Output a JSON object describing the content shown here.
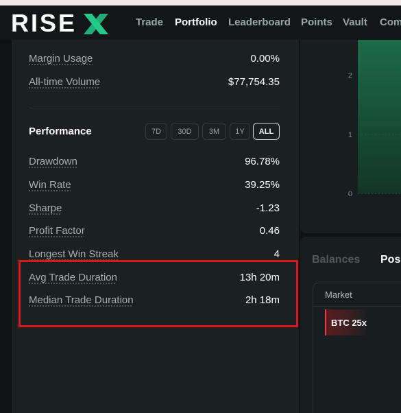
{
  "brand": {
    "logo_text": "RISE",
    "logo_mark": "X",
    "accent": "#22c98a"
  },
  "nav": {
    "items": [
      {
        "label": "Trade",
        "active": false
      },
      {
        "label": "Portfolio",
        "active": true
      },
      {
        "label": "Leaderboard",
        "active": false
      },
      {
        "label": "Points",
        "active": false
      },
      {
        "label": "Vault",
        "active": false
      },
      {
        "label": "Com",
        "active": false
      }
    ]
  },
  "summary": {
    "margin_usage": {
      "label": "Margin Usage",
      "value": "0.00%"
    },
    "alltime_volume": {
      "label": "All-time Volume",
      "value": "$77,754.35"
    }
  },
  "performance": {
    "title": "Performance",
    "timeframes": [
      "7D",
      "30D",
      "3M",
      "1Y",
      "ALL"
    ],
    "selected_timeframe": "ALL",
    "metrics": [
      {
        "label": "Drawdown",
        "value": "96.78%"
      },
      {
        "label": "Win Rate",
        "value": "39.25%"
      },
      {
        "label": "Sharpe",
        "value": "-1.23"
      },
      {
        "label": "Profit Factor",
        "value": "0.46"
      },
      {
        "label": "Longest Win Streak",
        "value": "4"
      },
      {
        "label": "Avg Trade Duration",
        "value": "13h 20m"
      },
      {
        "label": "Median Trade Duration",
        "value": "2h 18m"
      }
    ]
  },
  "chart_data": {
    "type": "area",
    "y_ticks": [
      "2",
      "1",
      "0"
    ],
    "ylim": [
      0,
      2.6
    ],
    "grid": true,
    "fill_color": "#1d6b47"
  },
  "positions": {
    "tabs": [
      {
        "label": "Balances",
        "active": false
      },
      {
        "label": "Pos",
        "active": true
      }
    ],
    "columns": [
      "Market"
    ],
    "rows": [
      {
        "market": "BTC 25x",
        "side_color": "#e0434b"
      }
    ]
  },
  "highlight_color": "#e0141a"
}
